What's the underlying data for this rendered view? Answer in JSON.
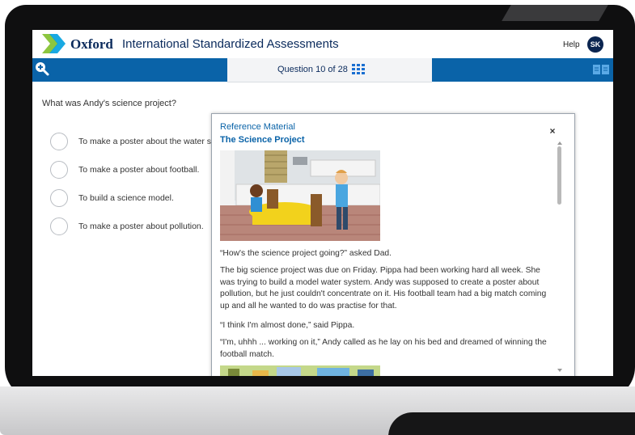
{
  "app": {
    "brand_name": "Oxford",
    "brand_subtitle": "International Standardized Assessments",
    "help_label": "Help",
    "user_initials": "SK"
  },
  "nav": {
    "question_indicator": "Question 10 of 28"
  },
  "question": {
    "prompt": "What was Andy's science project?",
    "options": [
      "To make a poster about the water s",
      "To make a poster about football.",
      "To build a science model.",
      "To make a poster about pollution."
    ]
  },
  "reference": {
    "title": "Reference Material",
    "subtitle": "The Science Project",
    "close_label": "×",
    "paragraphs": [
      "“How's the science project going?” asked Dad.",
      "The big science project was due on Friday. Pippa had been working hard all week. She was trying to build a model water system. Andy was supposed to create a poster about pollution, but he just couldn't concentrate on it. His football team had a big match coming up and all he wanted to do was practise for that.",
      "“I think I'm almost done,” said Pippa.",
      "“I'm, uhhh ... working on it,” Andy called as he lay on his bed and dreamed of winning the football match."
    ]
  },
  "colors": {
    "nav_blue": "#0a63a8",
    "brand_navy": "#0a2a5c",
    "logo_green": "#8cc63f",
    "logo_blue": "#00a0df"
  },
  "icons": {
    "zoom": "zoom-in-icon",
    "grid": "grid-icon",
    "book": "book-icon",
    "close": "close-icon"
  }
}
